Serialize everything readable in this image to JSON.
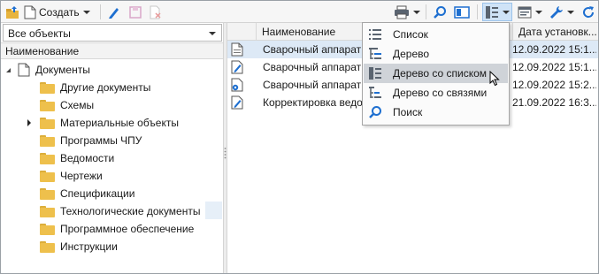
{
  "toolbar": {
    "create_label": "Создать"
  },
  "left_panel": {
    "filter_value": "Все объекты",
    "column_header": "Наименование",
    "tree": [
      {
        "label": "Документы",
        "level": 0,
        "expanded": true,
        "icon": "document-icon"
      },
      {
        "label": "Другие документы",
        "level": 1,
        "icon": "folder-icon"
      },
      {
        "label": "Схемы",
        "level": 1,
        "icon": "folder-icon"
      },
      {
        "label": "Материальные объекты",
        "level": 1,
        "icon": "folder-icon",
        "has_children": true
      },
      {
        "label": "Программы ЧПУ",
        "level": 1,
        "icon": "folder-icon"
      },
      {
        "label": "Ведомости",
        "level": 1,
        "icon": "folder-icon"
      },
      {
        "label": "Чертежи",
        "level": 1,
        "icon": "folder-icon"
      },
      {
        "label": "Спецификации",
        "level": 1,
        "icon": "folder-icon"
      },
      {
        "label": "Технологические документы",
        "level": 1,
        "icon": "folder-icon",
        "selected": true
      },
      {
        "label": "Программное обеспечение",
        "level": 1,
        "icon": "folder-icon"
      },
      {
        "label": "Инструкции",
        "level": 1,
        "icon": "folder-icon"
      }
    ]
  },
  "right_panel": {
    "columns": [
      "Наименование",
      "Дата установк..."
    ],
    "rows": [
      {
        "name": "Сварочный аппарат",
        "date": "12.09.2022 15:1...",
        "icon": "document-icon"
      },
      {
        "name": "Сварочный аппарат",
        "date": "12.09.2022 15:1...",
        "icon": "edit-document-icon"
      },
      {
        "name": "Сварочный аппарат",
        "date": "12.09.2022 15:2...",
        "icon": "gear-document-icon"
      },
      {
        "name": "Корректировка ведо",
        "date": "21.09.2022 16:3...",
        "icon": "edit-document-icon"
      }
    ]
  },
  "view_menu": {
    "items": [
      {
        "label": "Список",
        "icon": "list-view-icon"
      },
      {
        "label": "Дерево",
        "icon": "tree-view-icon"
      },
      {
        "label": "Дерево со списком",
        "icon": "tree-list-view-icon",
        "hovered": true
      },
      {
        "label": "Дерево со связями",
        "icon": "tree-links-view-icon"
      },
      {
        "label": "Поиск",
        "icon": "search-icon"
      }
    ]
  },
  "colors": {
    "accent": "#1e6fd0",
    "selection": "#dde9f6",
    "menu_hover": "#cfd3d8",
    "folder": "#eec04c"
  }
}
